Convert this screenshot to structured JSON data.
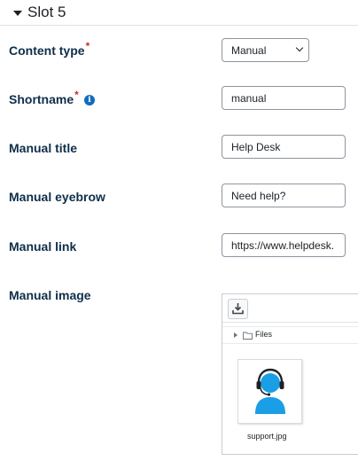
{
  "section": {
    "title": "Slot 5"
  },
  "fields": {
    "content_type": {
      "label": "Content type",
      "required_marker": "*",
      "selected": "Manual"
    },
    "shortname": {
      "label": "Shortname",
      "required_marker": "*",
      "value": "manual",
      "help_icon": "info-icon"
    },
    "manual_title": {
      "label": "Manual title",
      "value": "Help Desk"
    },
    "manual_eyebrow": {
      "label": "Manual eyebrow",
      "value": "Need help?"
    },
    "manual_link": {
      "label": "Manual link",
      "value": "https://www.helpdesk."
    },
    "manual_image": {
      "label": "Manual image"
    }
  },
  "file_manager": {
    "toolbar_icon": "download-icon",
    "path_label": "Files",
    "file": {
      "name": "support.jpg",
      "thumbnail_icon": "support-agent-icon"
    }
  },
  "colors": {
    "label": "#0f2e4a",
    "required": "#ca3120",
    "info": "#0f6cbf",
    "thumbnail_figure": "#1a9ee5"
  }
}
